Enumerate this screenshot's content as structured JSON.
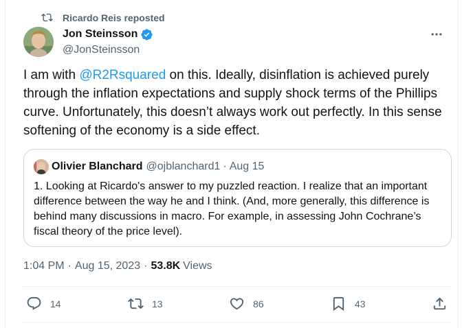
{
  "repost": {
    "label": "Ricardo Reis reposted",
    "icon": "repost-icon"
  },
  "author": {
    "name": "Jon Steinsson",
    "handle": "@JonSteinsson",
    "verified_icon": "verified-badge-icon"
  },
  "tweet": {
    "text_before": "I am with ",
    "mention": "@R2Rsquared",
    "text_after": " on this. Ideally, disinflation is achieved purely through the inflation expectations and supply shock terms of the Phillips curve. Unfortunately, this doesn’t always work out perfectly. In this sense softening of the economy is a side effect."
  },
  "quote": {
    "name": "Olivier Blanchard",
    "handle": "@ojblanchard1",
    "separator": "·",
    "date": "Aug 15",
    "text": "1. Looking at Ricardo's answer to my puzzled reaction.  I realize that an important difference between the way he and I think. (And, more generally, this difference is behind many discussions in macro.  For example, in assessing John Cochrane’s fiscal theory of the price level)."
  },
  "meta": {
    "time": "1:04 PM",
    "date": "Aug 15, 2023",
    "separator": "·",
    "views_count": "53.8K",
    "views_label": "Views"
  },
  "actions": {
    "replies": "14",
    "reposts": "13",
    "likes": "86",
    "bookmarks": "43"
  },
  "colors": {
    "accent": "#1d9bf0",
    "text": "#0f1419",
    "muted": "#536471",
    "border": "#cfd9de"
  }
}
